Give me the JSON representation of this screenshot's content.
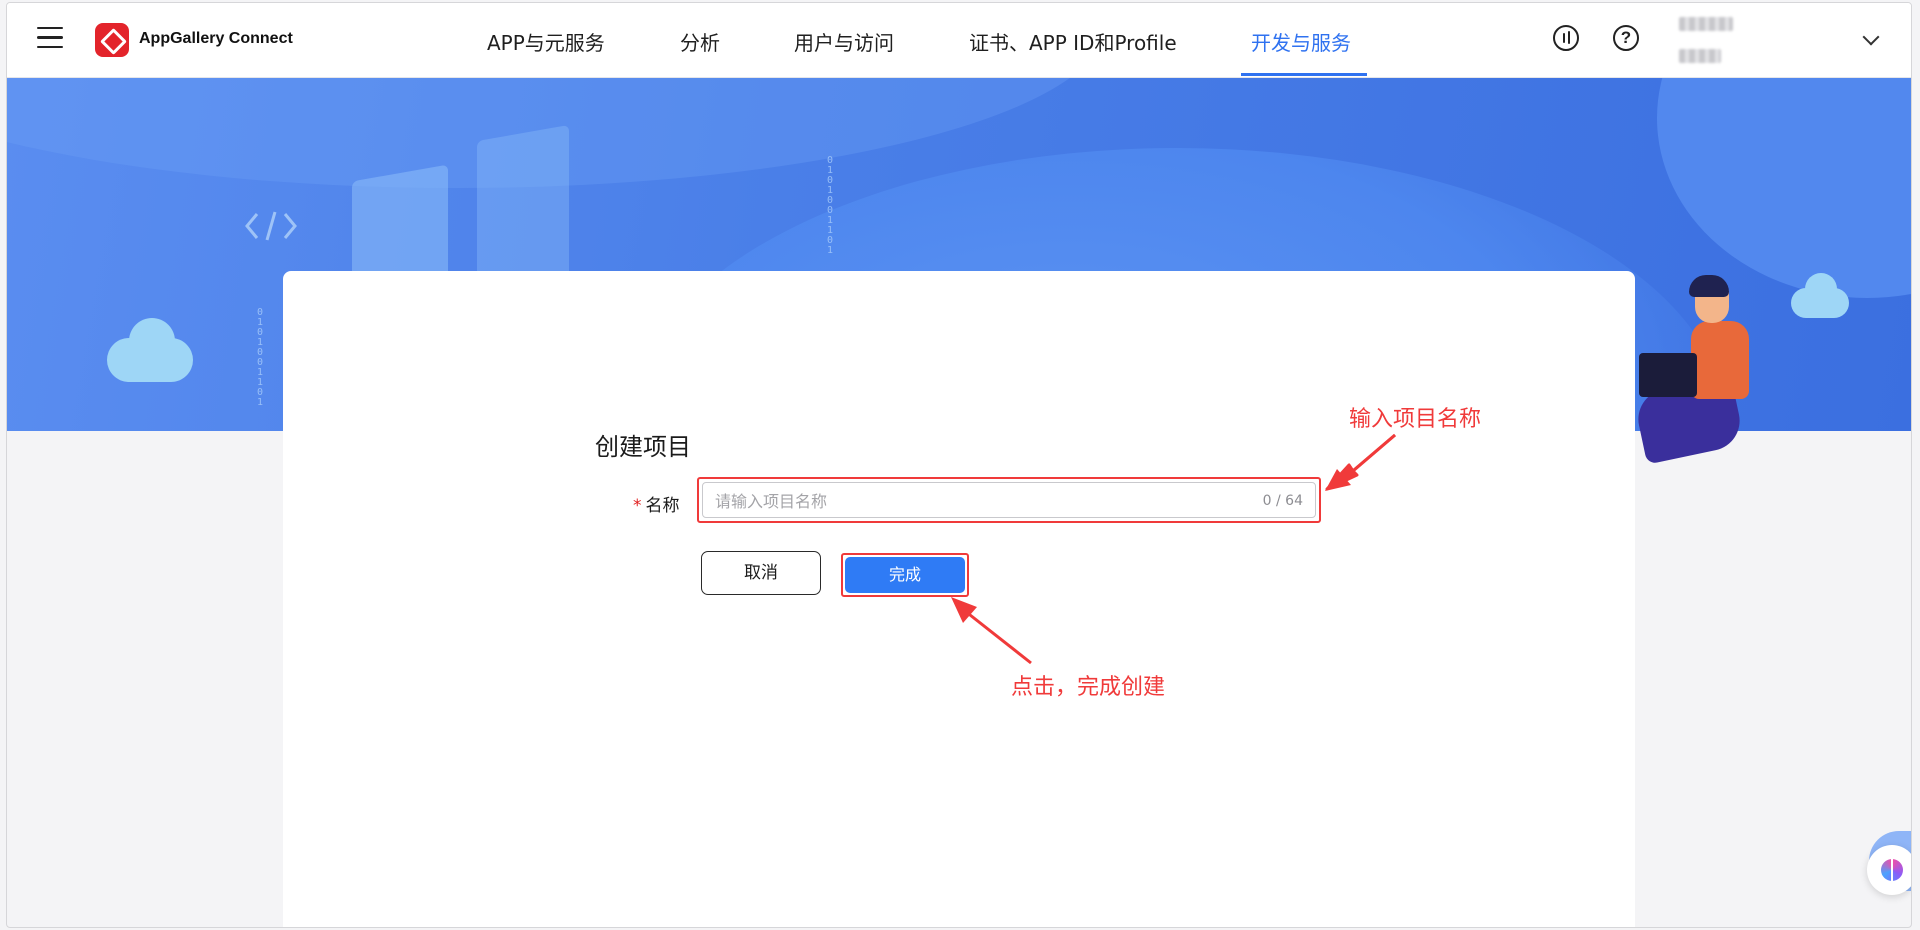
{
  "header": {
    "brand": "AppGallery Connect",
    "nav": [
      {
        "label": "APP与元服务",
        "active": false
      },
      {
        "label": "分析",
        "active": false
      },
      {
        "label": "用户与访问",
        "active": false
      },
      {
        "label": "证书、APP ID和Profile",
        "active": false
      },
      {
        "label": "开发与服务",
        "active": true
      }
    ],
    "icons": [
      "feedback-icon",
      "help-icon"
    ],
    "help_glyph": "?"
  },
  "form": {
    "title": "创建项目",
    "name_label": "名称",
    "required_mark": "*",
    "name_placeholder": "请输入项目名称",
    "name_value": "",
    "counter": "0 / 64",
    "cancel_label": "取消",
    "submit_label": "完成"
  },
  "annotations": {
    "input_hint": "输入项目名称",
    "submit_hint": "点击，完成创建"
  },
  "colors": {
    "accent": "#2f72f0",
    "annotation": "#f03a3a",
    "brand_red": "#e3242b"
  }
}
